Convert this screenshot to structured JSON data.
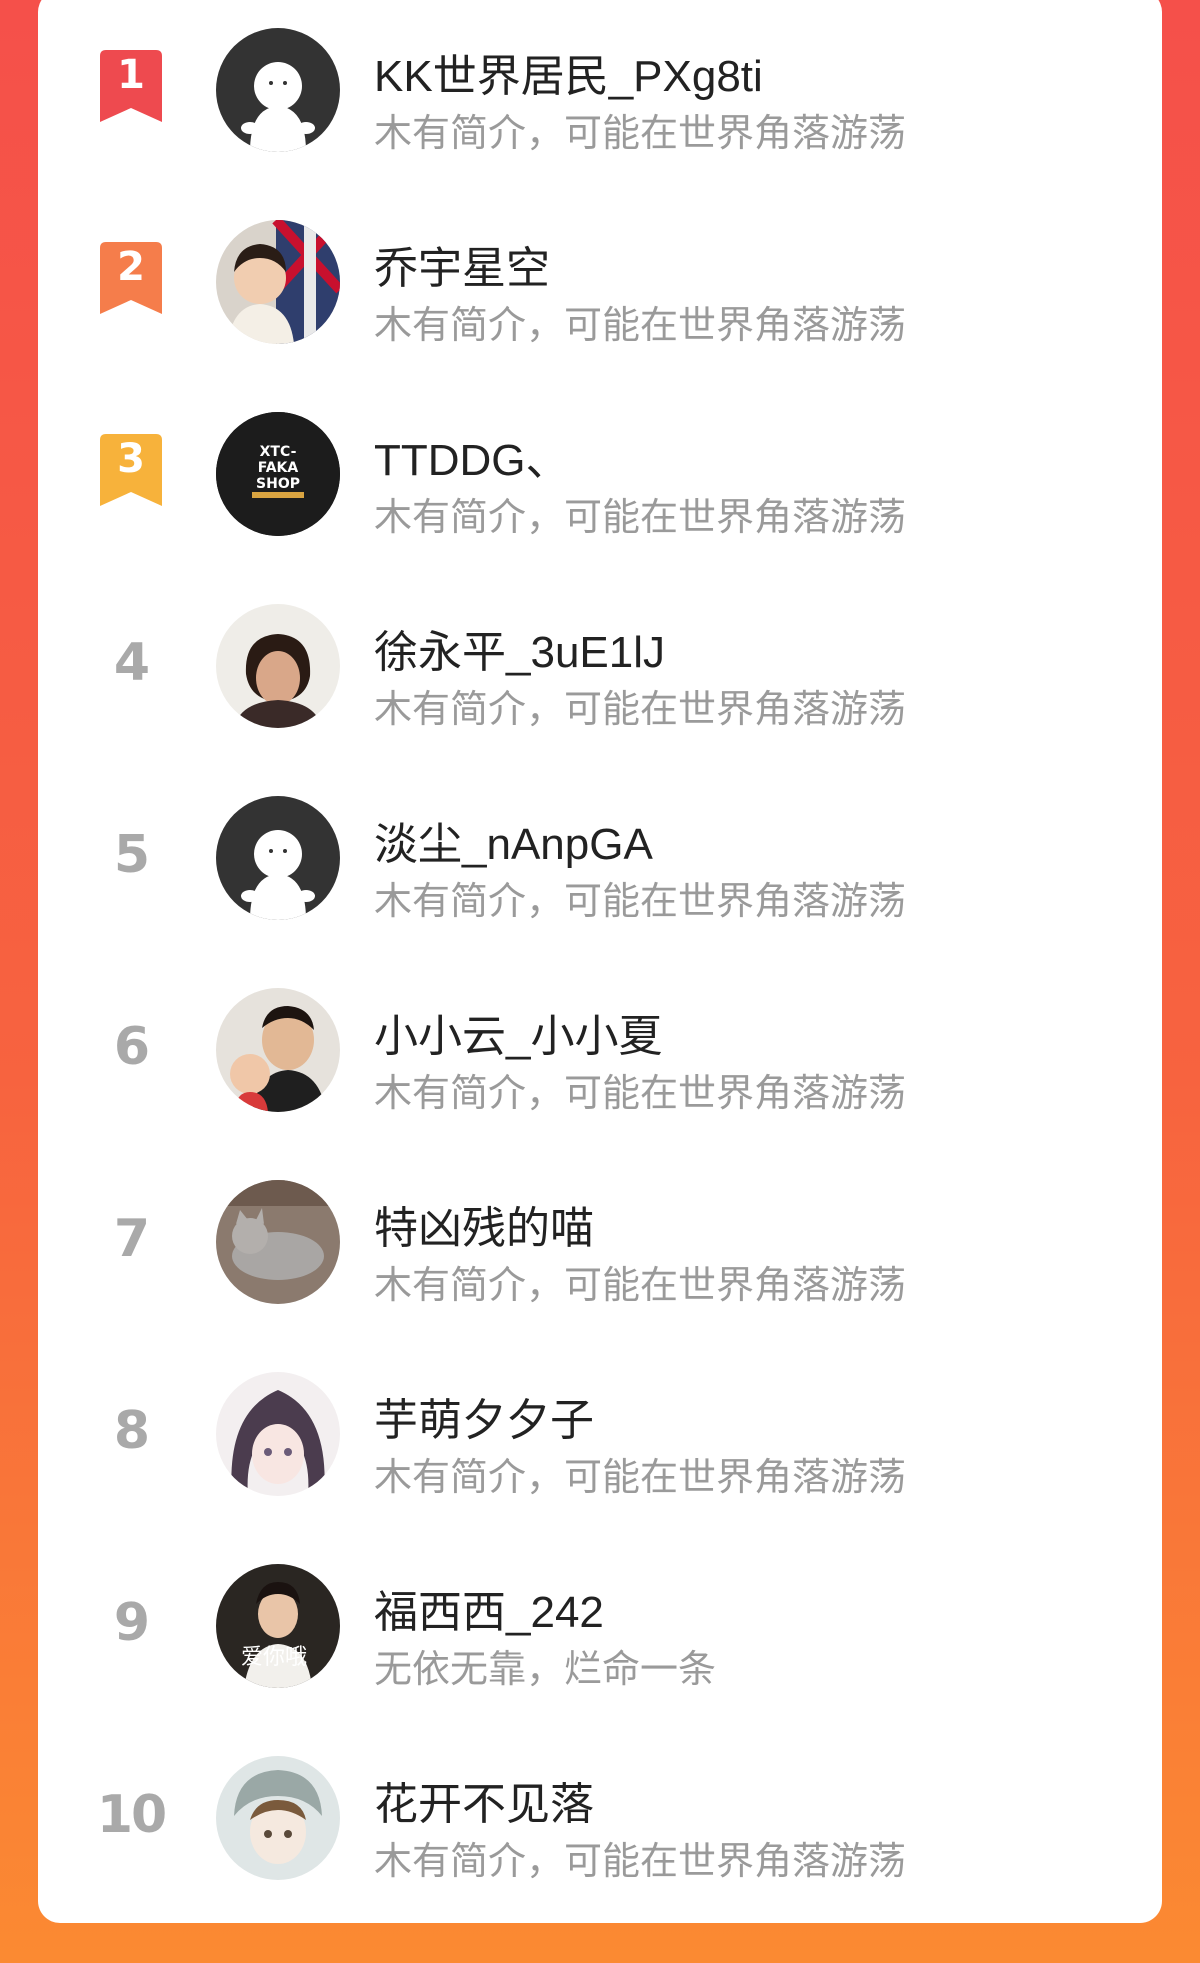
{
  "colors": {
    "rank1": "#ee4a4f",
    "rank2": "#f57d4b",
    "rank3": "#f7b23b",
    "rank_plain": "#a9a9a9",
    "name": "#222222",
    "bio": "#9a9a9a"
  },
  "users": [
    {
      "rank": "1",
      "name": "KK世界居民_PXg8ti",
      "bio": "木有简介，可能在世界角落游荡",
      "avatar": "default-ghost-avatar"
    },
    {
      "rank": "2",
      "name": "乔宇星空",
      "bio": "木有简介，可能在世界角落游荡",
      "avatar": "child-photo-avatar"
    },
    {
      "rank": "3",
      "name": "TTDDG、",
      "bio": "木有简介，可能在世界角落游荡",
      "avatar": "xtc-faka-shop-logo",
      "avatar_text": [
        "XTC-",
        "FAKA",
        "SHOP"
      ]
    },
    {
      "rank": "4",
      "name": "徐永平_3uE1lJ",
      "bio": "木有简介，可能在世界角落游荡",
      "avatar": "woman-photo-avatar"
    },
    {
      "rank": "5",
      "name": "淡尘_nAnpGA",
      "bio": "木有简介，可能在世界角落游荡",
      "avatar": "default-ghost-avatar"
    },
    {
      "rank": "6",
      "name": "小小云_小小夏",
      "bio": "木有简介，可能在世界角落游荡",
      "avatar": "father-child-photo-avatar"
    },
    {
      "rank": "7",
      "name": "特凶残的喵",
      "bio": "木有简介，可能在世界角落游荡",
      "avatar": "cat-photo-avatar"
    },
    {
      "rank": "8",
      "name": "芋萌夕夕子",
      "bio": "木有简介，可能在世界角落游荡",
      "avatar": "anime-girl-avatar"
    },
    {
      "rank": "9",
      "name": "福西西_242",
      "bio": "无依无靠，烂命一条",
      "avatar": "boy-photo-avatar",
      "avatar_text": [
        "爱你哦"
      ]
    },
    {
      "rank": "10",
      "name": "花开不见落",
      "bio": "木有简介，可能在世界角落游荡",
      "avatar": "anime-character-avatar"
    }
  ]
}
